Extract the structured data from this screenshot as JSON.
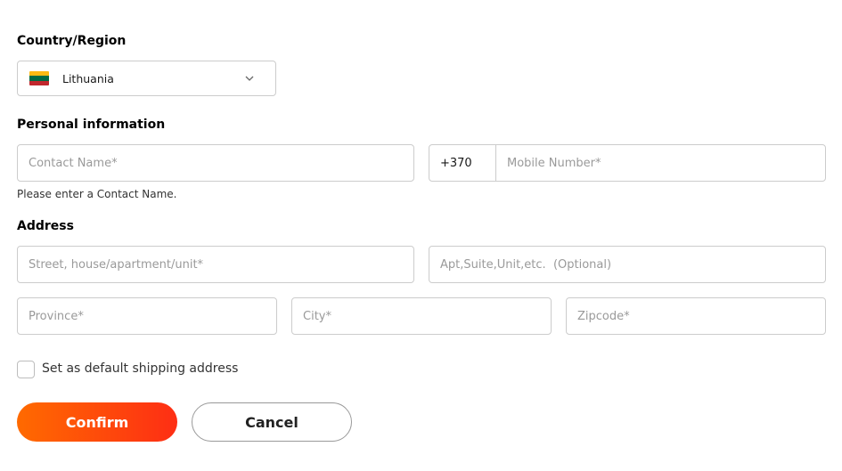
{
  "country": {
    "title": "Country/Region",
    "selected": "Lithuania",
    "flag_colors": [
      "#FDB913",
      "#006A44",
      "#C1272D"
    ],
    "dropdown_icon": "chevron-down-icon"
  },
  "personal": {
    "title": "Personal information",
    "contact_placeholder": "Contact Name*",
    "contact_error": "Please enter a Contact Name.",
    "phone_code": "+370",
    "mobile_placeholder": "Mobile Number*"
  },
  "address": {
    "title": "Address",
    "street_placeholder": "Street, house/apartment/unit*",
    "apt_placeholder": "Apt,Suite,Unit,etc.  (Optional)",
    "province_placeholder": "Province*",
    "city_placeholder": "City*",
    "zipcode_placeholder": "Zipcode*"
  },
  "default_checkbox": {
    "label": "Set as default shipping address",
    "checked": false
  },
  "actions": {
    "confirm_label": "Confirm",
    "cancel_label": "Cancel",
    "accent_gradient": [
      "#ff6a00",
      "#fe2e14"
    ]
  }
}
